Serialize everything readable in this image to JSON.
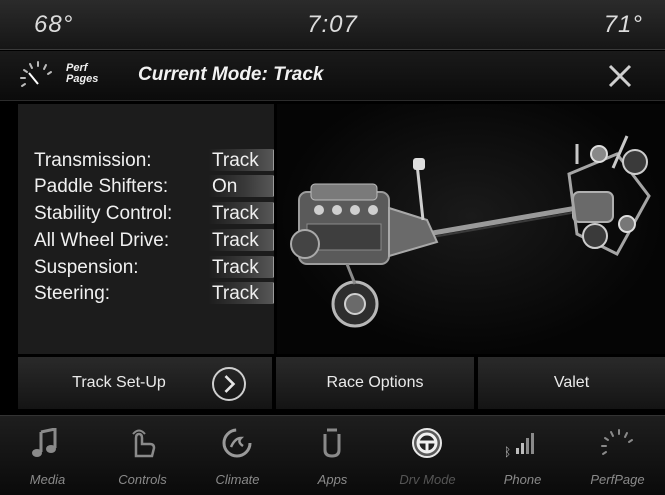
{
  "status": {
    "temp_left": "68°",
    "time": "7:07",
    "temp_right": "71°"
  },
  "header": {
    "perf_line1": "Perf",
    "perf_line2": "Pages",
    "title": "Current Mode: Track",
    "close_icon": "close-icon"
  },
  "settings": [
    {
      "label": "Transmission:",
      "value": "Track"
    },
    {
      "label": "Paddle Shifters:",
      "value": "On"
    },
    {
      "label": "Stability Control:",
      "value": "Track"
    },
    {
      "label": "All Wheel Drive:",
      "value": "Track"
    },
    {
      "label": "Suspension:",
      "value": "Track"
    },
    {
      "label": "Steering:",
      "value": "Track"
    }
  ],
  "buttons": {
    "track_setup": "Track Set-Up",
    "race_options": "Race Options",
    "valet": "Valet"
  },
  "nav": [
    {
      "label": "Media",
      "icon": "music-note-icon"
    },
    {
      "label": "Controls",
      "icon": "hand-touch-icon"
    },
    {
      "label": "Climate",
      "icon": "climate-icon"
    },
    {
      "label": "Apps",
      "icon": "apps-icon"
    },
    {
      "label": "Drv Mode",
      "icon": "steering-wheel-icon",
      "active": true
    },
    {
      "label": "Phone",
      "icon": "phone-signal-icon"
    },
    {
      "label": "PerfPage",
      "icon": "gauge-icon"
    }
  ]
}
